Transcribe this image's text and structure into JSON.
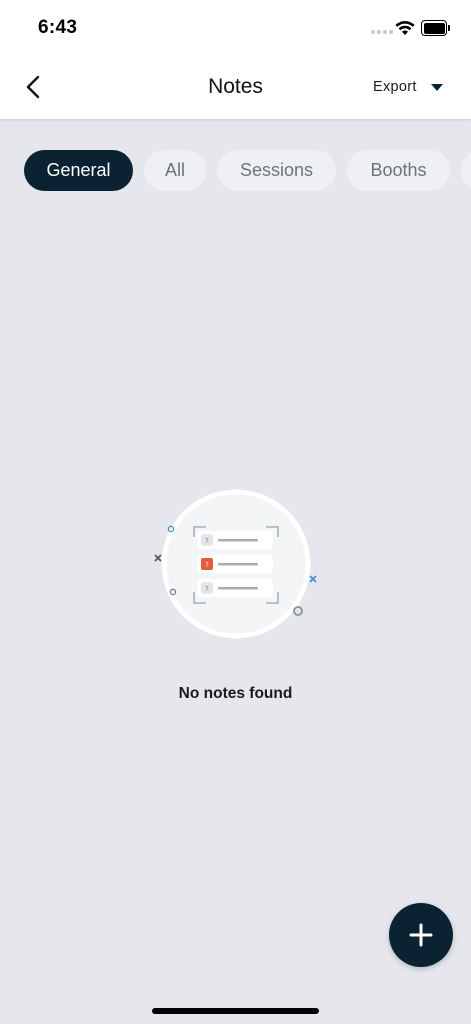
{
  "status_bar": {
    "time": "6:43"
  },
  "header": {
    "title": "Notes",
    "export_label": "Export"
  },
  "tabs": [
    {
      "label": "General",
      "active": true
    },
    {
      "label": "All",
      "active": false
    },
    {
      "label": "Sessions",
      "active": false
    },
    {
      "label": "Booths",
      "active": false
    }
  ],
  "empty_state": {
    "message": "No notes found"
  },
  "colors": {
    "primary": "#0b2233",
    "background": "#e5e7ec",
    "accent_orange": "#e85a3c",
    "accent_blue": "#3a8fd1"
  },
  "icons": [
    "back-chevron-icon",
    "caret-down-icon",
    "wifi-icon",
    "battery-icon",
    "plus-icon"
  ]
}
